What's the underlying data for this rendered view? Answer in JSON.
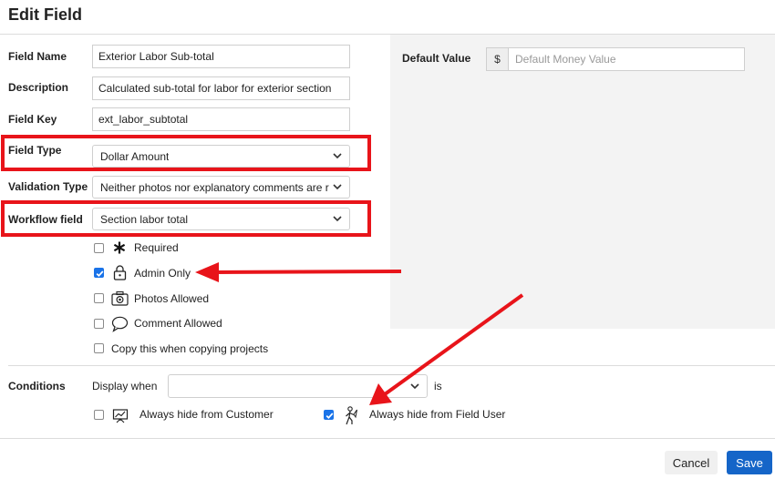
{
  "dialog": {
    "title": "Edit Field"
  },
  "form": {
    "field_name": {
      "label": "Field Name",
      "value": "Exterior Labor Sub-total"
    },
    "description": {
      "label": "Description",
      "value": "Calculated sub-total for labor for exterior section"
    },
    "field_key": {
      "label": "Field Key",
      "value": "ext_labor_subtotal"
    },
    "field_type": {
      "label": "Field Type",
      "value": "Dollar Amount"
    },
    "validation_type": {
      "label": "Validation Type",
      "value": "Neither photos nor explanatory comments are re"
    },
    "workflow_field": {
      "label": "Workflow field",
      "value": "Section labor total"
    }
  },
  "options": [
    {
      "label": "Required",
      "checked": false,
      "icon": "asterisk-icon"
    },
    {
      "label": "Admin Only",
      "checked": true,
      "icon": "lock-icon"
    },
    {
      "label": "Photos Allowed",
      "checked": false,
      "icon": "camera-icon"
    },
    {
      "label": "Comment Allowed",
      "checked": false,
      "icon": "comment-bubble-icon"
    },
    {
      "label": "Copy this when copying projects",
      "checked": false,
      "icon": ""
    }
  ],
  "default_value": {
    "label": "Default Value",
    "currency": "$",
    "placeholder": "Default Money Value",
    "value": ""
  },
  "conditions": {
    "label": "Conditions",
    "display_when": "Display when",
    "selected": "",
    "is_text": "is",
    "hide_customer": {
      "label": "Always hide from Customer",
      "checked": false,
      "icon": "presentation-chart-icon"
    },
    "hide_field_user": {
      "label": "Always hide from Field User",
      "checked": true,
      "icon": "field-worker-icon"
    }
  },
  "footer": {
    "cancel": "Cancel",
    "save": "Save"
  },
  "colors": {
    "highlight": "#e8141a",
    "primary": "#1565c8",
    "checkbox": "#1a73e8",
    "panel": "#f3f3f3"
  }
}
